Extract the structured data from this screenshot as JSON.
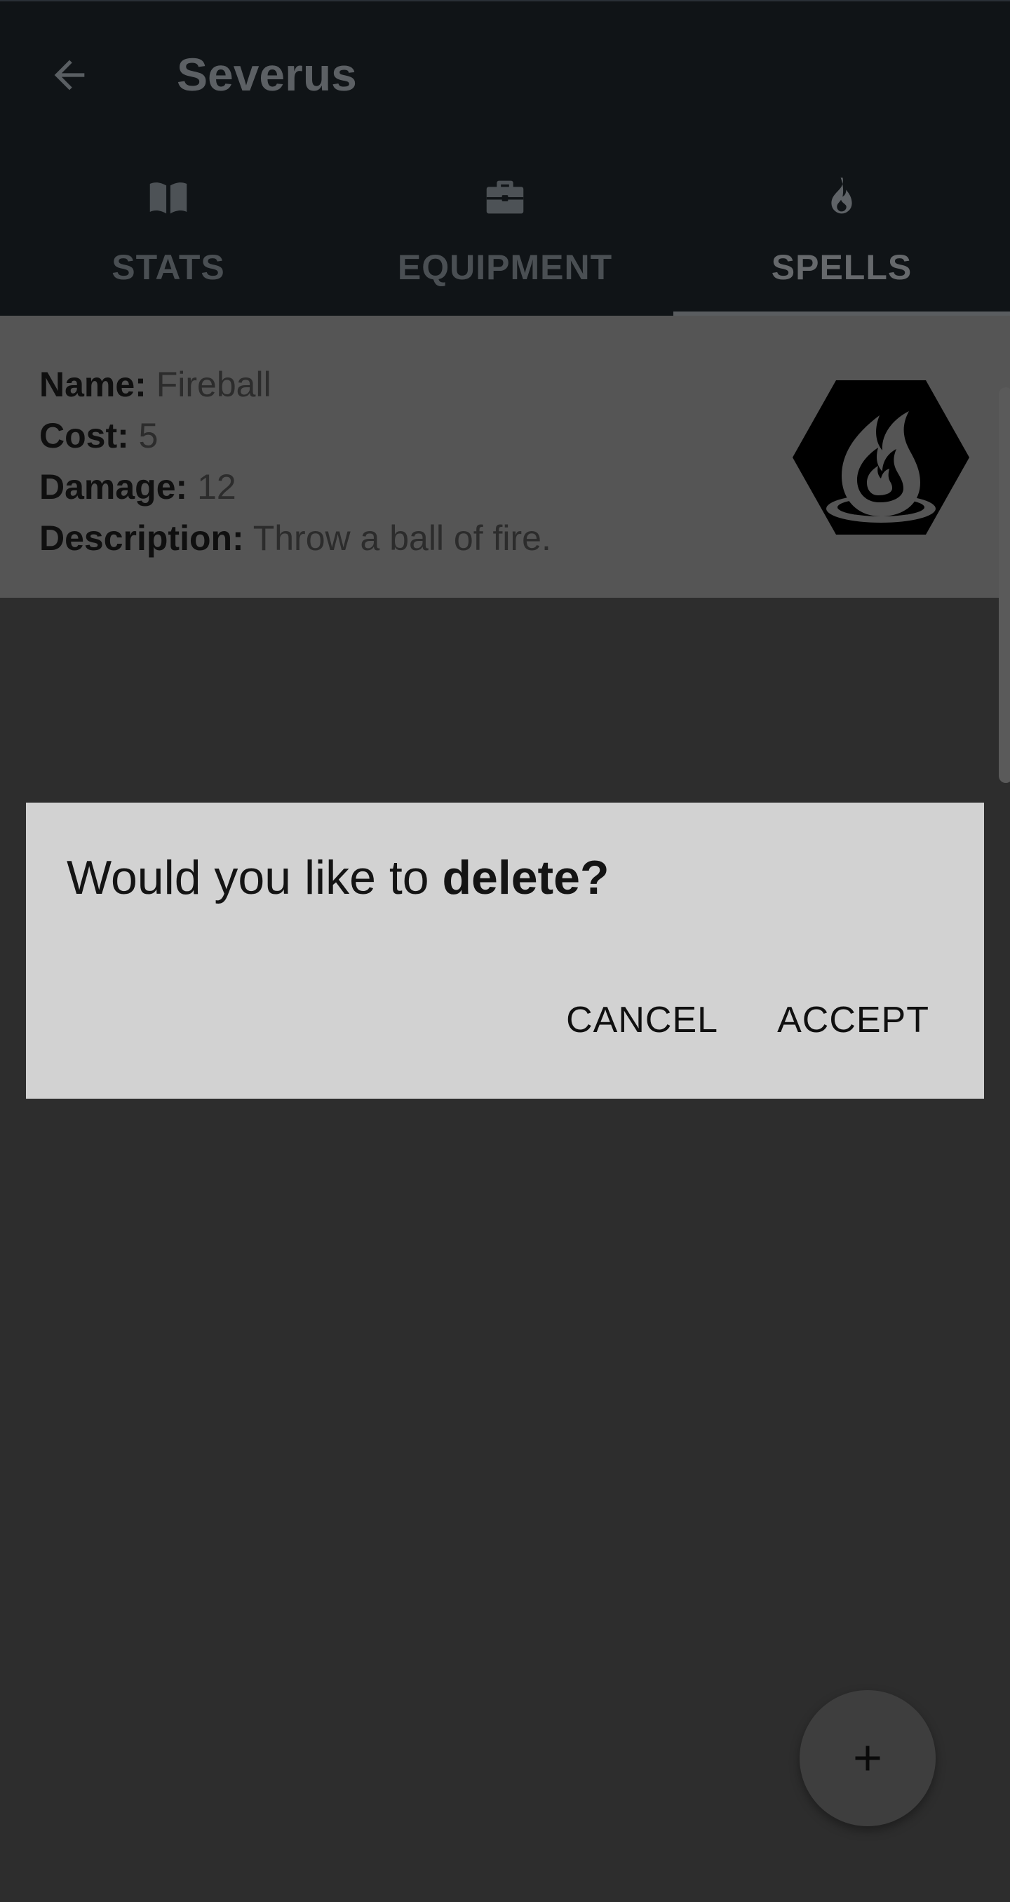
{
  "header": {
    "title": "Severus",
    "back_icon": "arrow-left-icon"
  },
  "tabs": [
    {
      "label": "STATS",
      "icon": "book-icon",
      "active": false
    },
    {
      "label": "EQUIPMENT",
      "icon": "briefcase-icon",
      "active": false
    },
    {
      "label": "SPELLS",
      "icon": "flame-icon",
      "active": true
    }
  ],
  "spell": {
    "name_key": "Name:",
    "name": "Fireball",
    "cost_key": "Cost:",
    "cost": "5",
    "damage_key": "Damage:",
    "damage": "12",
    "description_key": "Description:",
    "description": "Throw a ball of fire.",
    "icon": "fireball-hexagon-icon"
  },
  "dialog": {
    "message_prefix": "Would you like to ",
    "message_bold": "delete?",
    "cancel_label": "CANCEL",
    "accept_label": "ACCEPT"
  },
  "fab": {
    "icon": "plus-icon"
  },
  "colors": {
    "appbar": "#101417",
    "background": "#2d2d2d",
    "card": "#555555",
    "dialog": "#d2d2d2"
  }
}
